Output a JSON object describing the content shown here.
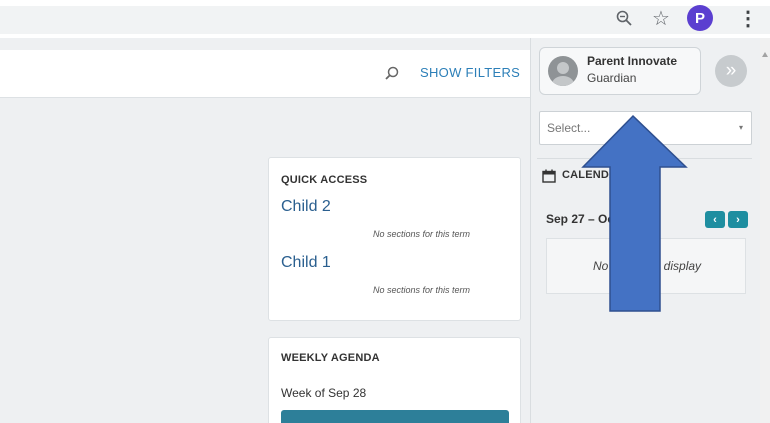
{
  "browser": {
    "profile_initial": "P",
    "icons": [
      "zoom-icon",
      "star-icon",
      "kebab-menu-icon"
    ]
  },
  "search": {
    "placeholder": "",
    "show_filters_label": "SHOW FILTERS"
  },
  "quick_access": {
    "title": "QUICK ACCESS",
    "children": [
      {
        "name": "Child 2",
        "note": "No sections for this term"
      },
      {
        "name": "Child 1",
        "note": "No sections for this term"
      }
    ]
  },
  "weekly_agenda": {
    "title": "WEEKLY AGENDA",
    "week_label": "Week of Sep 28"
  },
  "user": {
    "name": "Parent Innovate",
    "role": "Guardian",
    "expand_glyph": "»"
  },
  "select": {
    "placeholder": "Select...",
    "caret": "▾"
  },
  "calendar": {
    "heading": "CALENDAR",
    "date_range": "Sep 27 – Oct 3",
    "prev_glyph": "‹",
    "next_glyph": "›",
    "empty_text": "No events to display"
  },
  "colors": {
    "accent_teal": "#1e8ea0",
    "link_blue": "#2a5f8f",
    "annotation_arrow": "#4472c4",
    "profile_purple": "#5b3fd0"
  }
}
